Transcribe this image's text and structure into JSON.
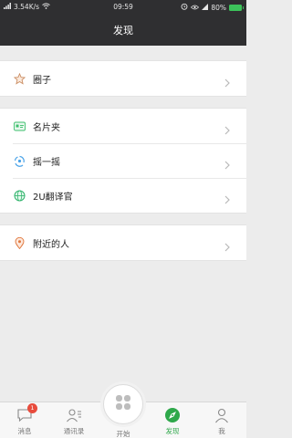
{
  "status": {
    "speed": "3.54K/s",
    "time": "09:59",
    "battery": "80%"
  },
  "header": {
    "title": "发现"
  },
  "groups": [
    {
      "items": [
        {
          "label": "圈子",
          "icon": "star-icon"
        }
      ]
    },
    {
      "items": [
        {
          "label": "名片夹",
          "icon": "card-holder-icon"
        },
        {
          "label": "摇一摇",
          "icon": "shake-icon"
        },
        {
          "label": "2U翻译官",
          "icon": "globe-icon"
        }
      ]
    },
    {
      "items": [
        {
          "label": "附近的人",
          "icon": "location-pin-icon"
        }
      ]
    }
  ],
  "tabs": [
    {
      "label": "消息",
      "icon": "message-icon",
      "badge": "1"
    },
    {
      "label": "通讯录",
      "icon": "contacts-icon"
    },
    {
      "label": "开始",
      "icon": "start-grid-icon"
    },
    {
      "label": "发现",
      "icon": "compass-icon",
      "active": true
    },
    {
      "label": "我",
      "icon": "person-icon"
    }
  ],
  "colors": {
    "header_bg": "#2f2f31",
    "accent_green": "#2ea84a",
    "badge_red": "#e84c3d",
    "page_bg": "#ececec"
  }
}
